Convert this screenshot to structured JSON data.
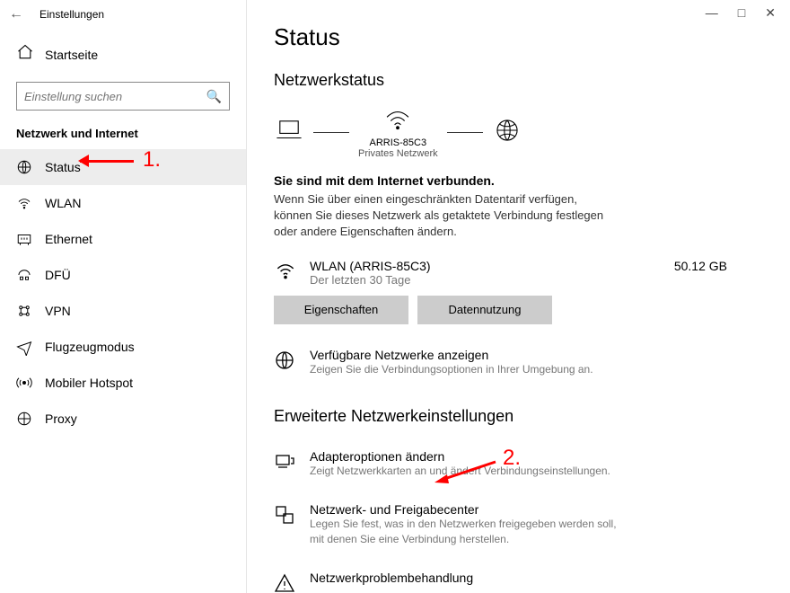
{
  "window": {
    "title": "Einstellungen"
  },
  "sidebar": {
    "home": "Startseite",
    "search_placeholder": "Einstellung suchen",
    "category": "Netzwerk und Internet",
    "items": [
      {
        "label": "Status",
        "icon": "globe-icon"
      },
      {
        "label": "WLAN",
        "icon": "wifi-icon"
      },
      {
        "label": "Ethernet",
        "icon": "ethernet-icon"
      },
      {
        "label": "DFÜ",
        "icon": "dialup-icon"
      },
      {
        "label": "VPN",
        "icon": "vpn-icon"
      },
      {
        "label": "Flugzeugmodus",
        "icon": "airplane-icon"
      },
      {
        "label": "Mobiler Hotspot",
        "icon": "hotspot-icon"
      },
      {
        "label": "Proxy",
        "icon": "proxy-icon"
      }
    ]
  },
  "main": {
    "title": "Status",
    "net_status_h": "Netzwerkstatus",
    "diagram": {
      "ssid": "ARRIS-85C3",
      "type": "Privates Netzwerk"
    },
    "connected_h": "Sie sind mit dem Internet verbunden.",
    "connected_p": "Wenn Sie über einen eingeschränkten Datentarif verfügen, können Sie dieses Netzwerk als getaktete Verbindung festlegen oder andere Eigenschaften ändern.",
    "usage": {
      "name": "WLAN (ARRIS-85C3)",
      "period": "Der letzten 30 Tage",
      "amount": "50.12 GB"
    },
    "btn_props": "Eigenschaften",
    "btn_usage": "Datennutzung",
    "avail_title": "Verfügbare Netzwerke anzeigen",
    "avail_sub": "Zeigen Sie die Verbindungsoptionen in Ihrer Umgebung an.",
    "adv_h": "Erweiterte Netzwerkeinstellungen",
    "adapter_title": "Adapteroptionen ändern",
    "adapter_sub": "Zeigt Netzwerkkarten an und ändert Verbindungseinstellungen.",
    "sharing_title": "Netzwerk- und Freigabecenter",
    "sharing_sub": "Legen Sie fest, was in den Netzwerken freigegeben werden soll, mit denen Sie eine Verbindung herstellen.",
    "troubleshoot_title": "Netzwerkproblembehandlung"
  },
  "annotations": {
    "one": "1.",
    "two": "2."
  }
}
